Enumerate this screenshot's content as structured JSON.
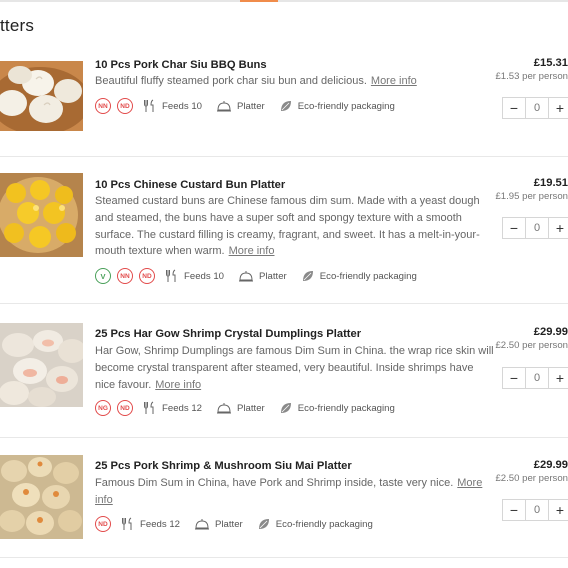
{
  "section": {
    "title": "tters"
  },
  "common": {
    "more_info": "More info",
    "platter_label": "Platter",
    "eco_label": "Eco-friendly packaging",
    "minus": "−",
    "plus": "+"
  },
  "items": [
    {
      "name": "10 Pcs Pork Char Siu BBQ Buns",
      "description": "Beautiful fluffy steamed pork char siu bun and delicious.",
      "badges": [
        "NN",
        "ND"
      ],
      "feeds": "Feeds 10",
      "price": "£15.31",
      "per_person": "£1.53 per person",
      "quantity": "0"
    },
    {
      "name": "10 Pcs Chinese Custard Bun Platter",
      "description": "Steamed custard buns are Chinese famous dim sum. Made with a yeast dough and steamed, the buns have a super soft and spongy texture with a smooth surface. The custard filling is creamy, fragrant, and sweet. It has a melt-in-your-mouth texture when warm.",
      "badges": [
        "V",
        "NN",
        "ND"
      ],
      "feeds": "Feeds 10",
      "price": "£19.51",
      "per_person": "£1.95 per person",
      "quantity": "0"
    },
    {
      "name": "25 Pcs Har Gow Shrimp Crystal Dumplings Platter",
      "description": "Har Gow, Shrimp Dumplings are famous Dim Sum in China. the wrap rice skin will become crystal transparent after steamed, very beautiful. Inside shrimps have nice favour.",
      "badges": [
        "NG",
        "ND"
      ],
      "feeds": "Feeds 12",
      "price": "£29.99",
      "per_person": "£2.50 per person",
      "quantity": "0"
    },
    {
      "name": "25 Pcs Pork Shrimp & Mushroom Siu Mai Platter",
      "description": "Famous Dim Sum in China, have Pork and Shrimp inside, taste very nice.",
      "badges": [
        "ND"
      ],
      "feeds": "Feeds 12",
      "price": "£29.99",
      "per_person": "£2.50 per person",
      "quantity": "0"
    }
  ]
}
